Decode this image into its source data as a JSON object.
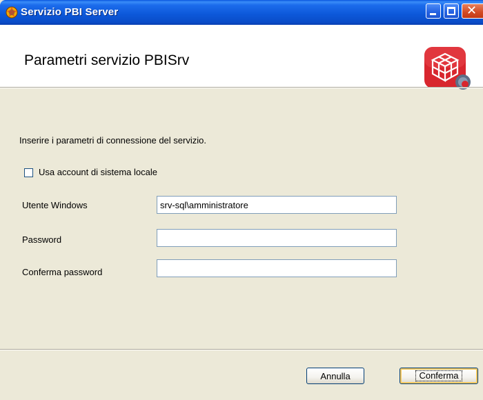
{
  "window": {
    "title": "Servizio PBI Server",
    "icon": "pbi-app-icon",
    "controls": {
      "minimize": "minimize-icon",
      "maximize": "maximize-icon",
      "close": "close-icon"
    }
  },
  "header": {
    "title": "Parametri servizio PBISrv",
    "logo": "pbi-service-logo"
  },
  "body": {
    "intro": "Inserire i parametri di connessione del servizio.",
    "local_account": {
      "label": "Usa account di sistema locale",
      "checked": false
    },
    "fields": {
      "user": {
        "label": "Utente Windows",
        "value": "srv-sql\\amministratore"
      },
      "password": {
        "label": "Password",
        "value": ""
      },
      "confirm": {
        "label": "Conferma password",
        "value": ""
      }
    }
  },
  "buttons": {
    "cancel": "Annulla",
    "confirm": "Conferma"
  },
  "colors": {
    "titlebar": "#0A57E0",
    "dialog_bg": "#ECE9D8",
    "logo_red": "#D8262E"
  }
}
